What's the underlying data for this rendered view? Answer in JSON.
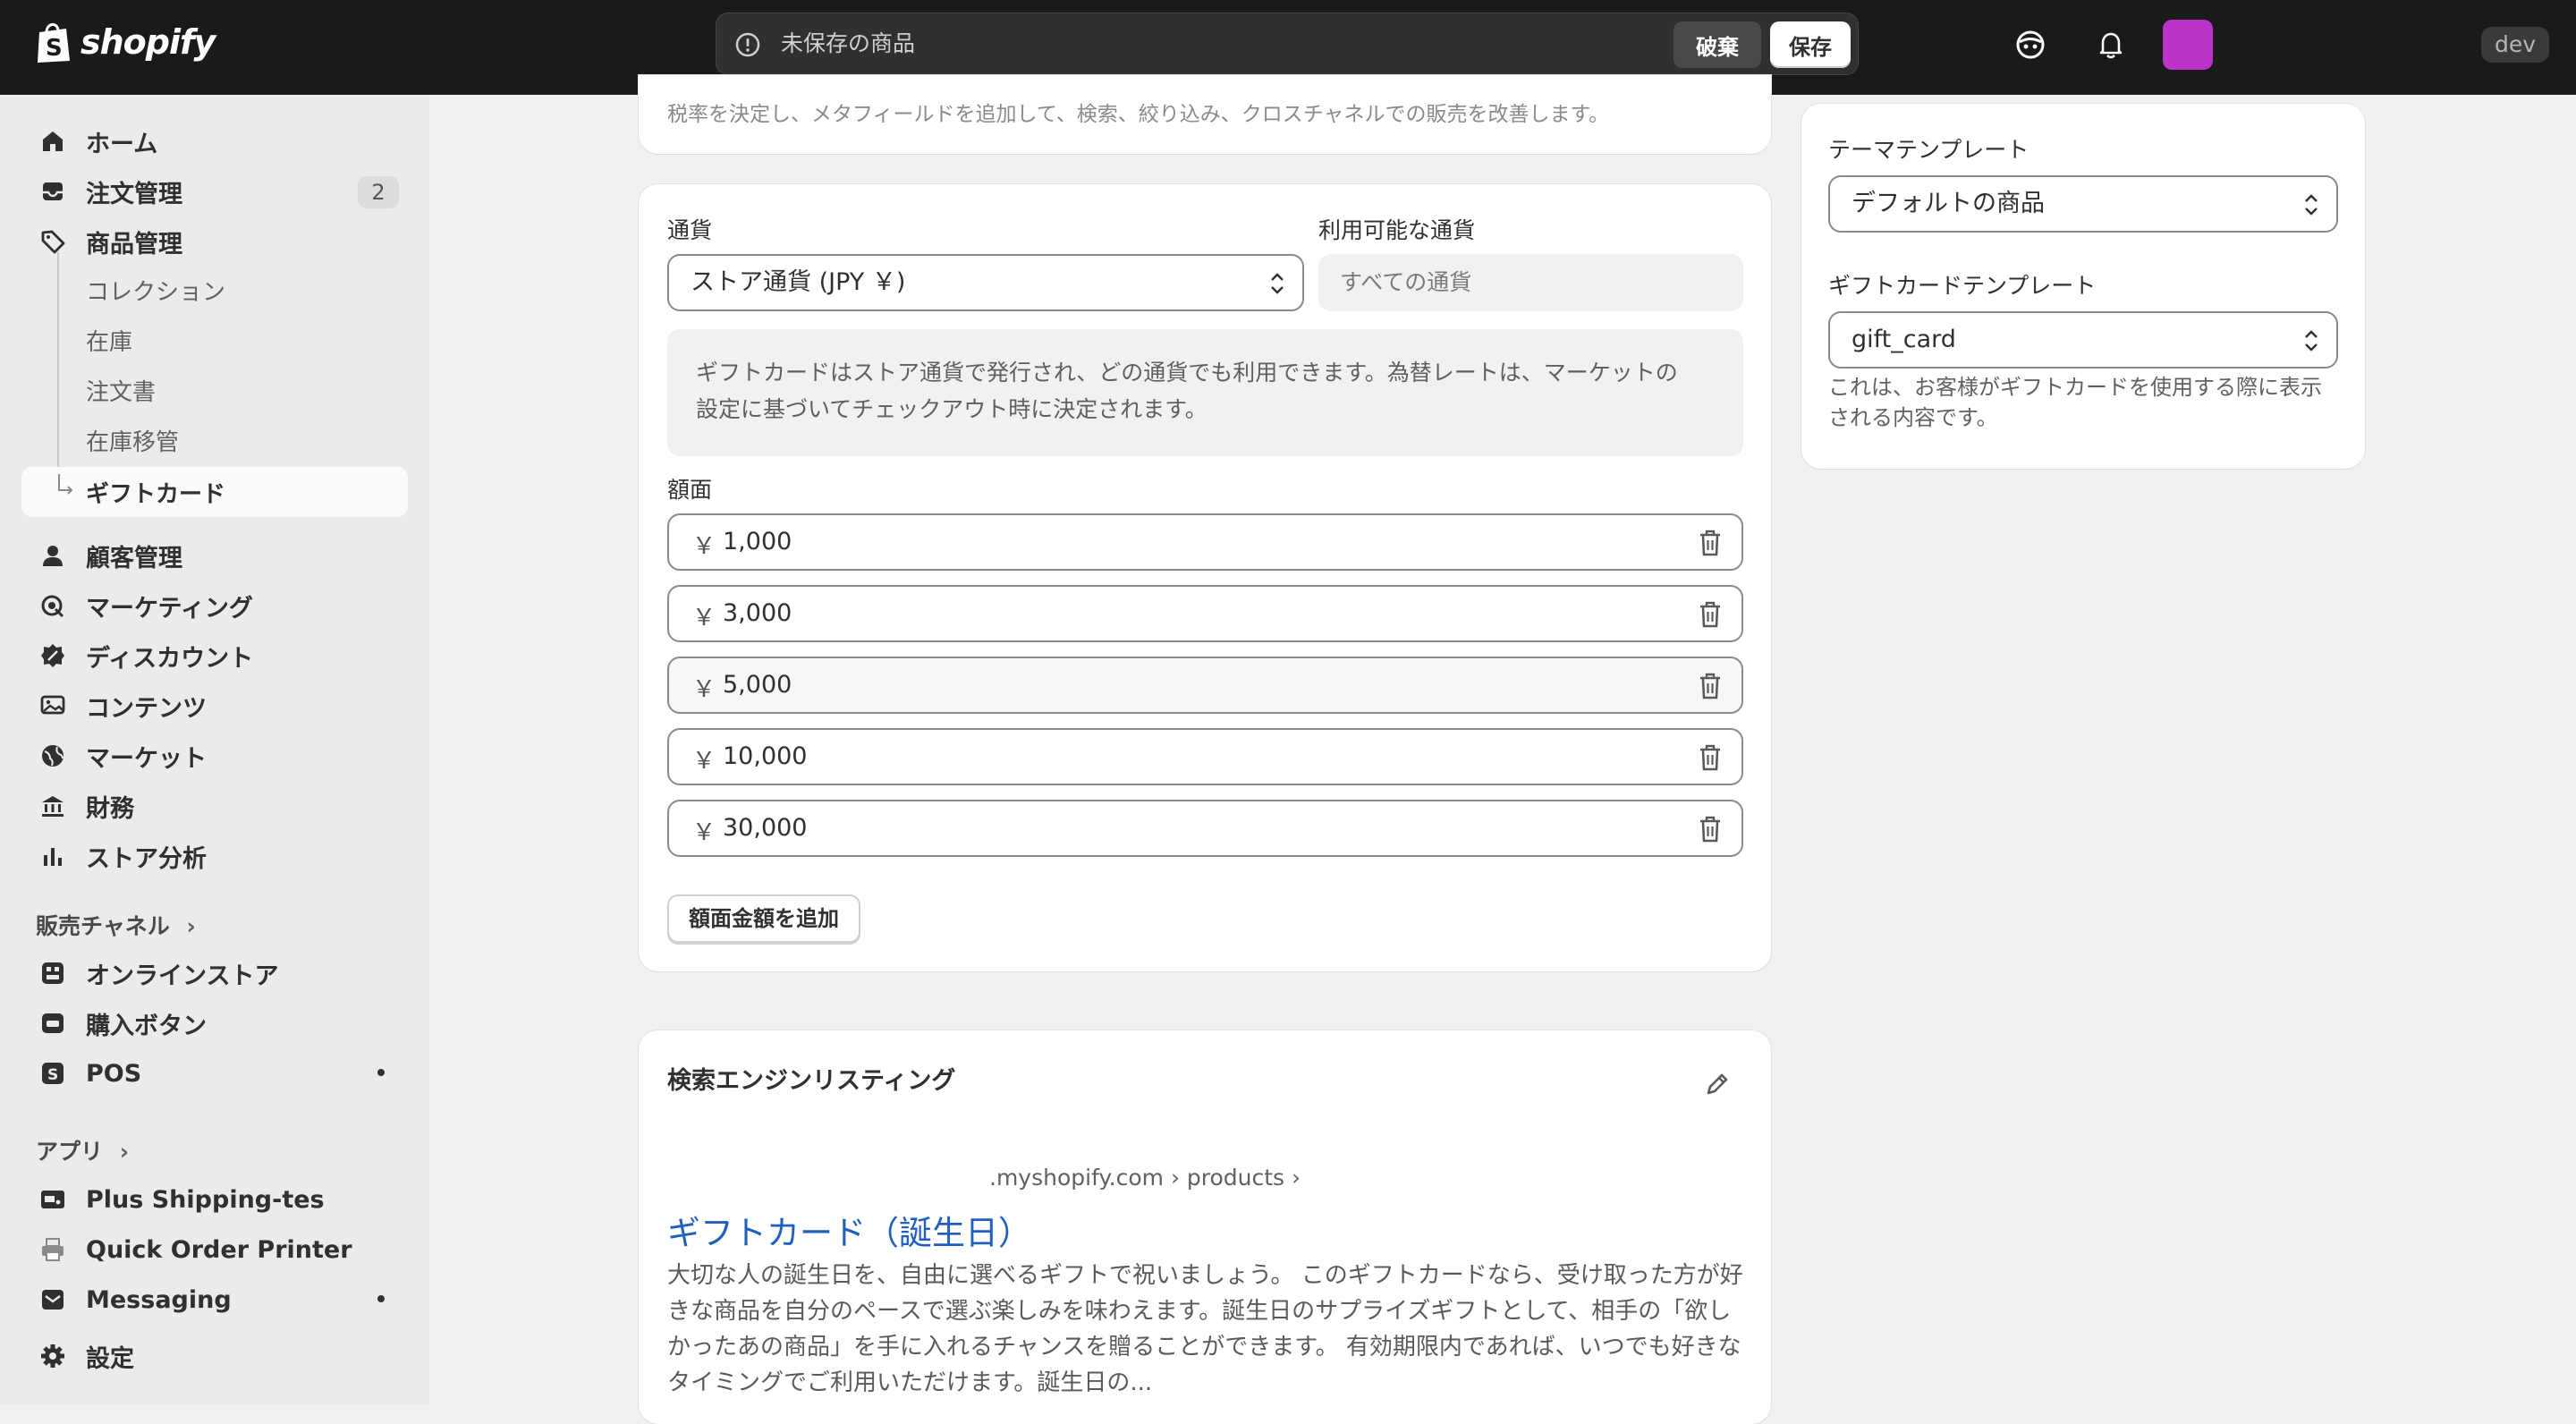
{
  "topbar": {
    "logo_text": "shopify",
    "unsaved_text": "未保存の商品",
    "discard_label": "破棄",
    "save_label": "保存",
    "dev_label": "dev",
    "avatar_color": "#bb33c9"
  },
  "sidebar": {
    "items": [
      {
        "label": "ホーム",
        "icon": "home-icon"
      },
      {
        "label": "注文管理",
        "icon": "inbox-icon",
        "badge": "2"
      },
      {
        "label": "商品管理",
        "icon": "tag-icon"
      },
      {
        "label": "コレクション"
      },
      {
        "label": "在庫"
      },
      {
        "label": "注文書"
      },
      {
        "label": "在庫移管"
      },
      {
        "label": "ギフトカード"
      },
      {
        "label": "顧客管理",
        "icon": "person-icon"
      },
      {
        "label": "マーケティング",
        "icon": "target-icon"
      },
      {
        "label": "ディスカウント",
        "icon": "discount-icon"
      },
      {
        "label": "コンテンツ",
        "icon": "content-icon"
      },
      {
        "label": "マーケット",
        "icon": "globe-icon"
      },
      {
        "label": "財務",
        "icon": "bank-icon"
      },
      {
        "label": "ストア分析",
        "icon": "chart-icon"
      }
    ],
    "sales_channels_heading": "販売チャネル",
    "channels": [
      {
        "label": "オンラインストア"
      },
      {
        "label": "購入ボタン"
      },
      {
        "label": "POS"
      }
    ],
    "apps_heading": "アプリ",
    "apps": [
      {
        "label": "Plus Shipping-tes"
      },
      {
        "label": "Quick Order Printer"
      },
      {
        "label": "Messaging"
      }
    ],
    "settings_label": "設定"
  },
  "main": {
    "top_card_text": "税率を決定し、メタフィールドを追加して、検索、絞り込み、クロスチャネルでの販売を改善します。",
    "currency_label": "通貨",
    "currency_value": "ストア通貨 (JPY ￥)",
    "available_currency_label": "利用可能な通貨",
    "available_currency_value": "すべての通貨",
    "info_line1": "ギフトカードはストア通貨で発行され、どの通貨でも利用できます。為替レートは、マーケットの",
    "info_line2": "設定に基づいてチェックアウト時に決定されます。",
    "denominations_label": "額面",
    "currency_symbol": "￥",
    "denominations": [
      "1,000",
      "3,000",
      "5,000",
      "10,000",
      "30,000"
    ],
    "add_denomination_label": "額面金額を追加",
    "seo": {
      "title": "検索エンジンリスティング",
      "url": ".myshopify.com › products ›",
      "link": "ギフトカード（誕生日）",
      "desc1": "大切な人の誕生日を、自由に選べるギフトで祝いましょう。 このギフトカードなら、受け取った方が好",
      "desc2": "きな商品を自分のペースで選ぶ楽しみを味わえます。誕生日のサプライズギフトとして、相手の「欲し",
      "desc3": "かったあの商品」を手に入れるチャンスを贈ることができます。 有効期限内であれば、いつでも好きな",
      "desc4": "タイミングでご利用いただけます。誕生日の..."
    }
  },
  "right": {
    "theme_template_label": "テーマテンプレート",
    "theme_template_value": "デフォルトの商品",
    "gift_template_label": "ギフトカードテンプレート",
    "gift_template_value": "gift_card",
    "help_line1": "これは、お客様がギフトカードを使用する際に表示",
    "help_line2": "される内容です。"
  }
}
